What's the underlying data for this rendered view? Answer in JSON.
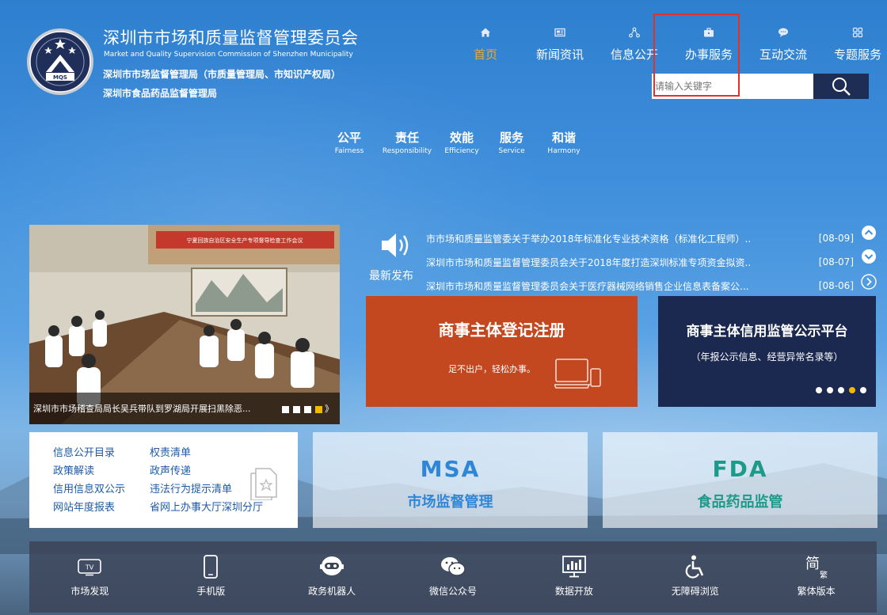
{
  "header": {
    "title": "深圳市市场和质量监督管理委员会",
    "title_en": "Market and Quality Supervision Commission of Shenzhen Municipality",
    "sub1": "深圳市市场监督管理局（市质量管理局、市知识产权局）",
    "sub2": "深圳市食品药品监督管理局",
    "logo_text": "MQS"
  },
  "nav": {
    "items": [
      {
        "label": "首页",
        "icon": "home-icon",
        "active": true
      },
      {
        "label": "新闻资讯",
        "icon": "newspaper-icon"
      },
      {
        "label": "信息公开",
        "icon": "network-icon"
      },
      {
        "label": "办事服务",
        "icon": "briefcase-icon"
      },
      {
        "label": "互动交流",
        "icon": "chat-icon"
      },
      {
        "label": "专题服务",
        "icon": "grid-icon"
      }
    ]
  },
  "search": {
    "placeholder": "请输入关键字"
  },
  "values": [
    {
      "zh": "公平",
      "en": "Fairness"
    },
    {
      "zh": "责任",
      "en": "Responsibility"
    },
    {
      "zh": "效能",
      "en": "Efficiency"
    },
    {
      "zh": "服务",
      "en": "Service"
    },
    {
      "zh": "和谐",
      "en": "Harmony"
    }
  ],
  "slider": {
    "caption": "深圳市市场稽查局局长吴兵带队到罗湖局开展扫黑除恶...",
    "banner_text": "宁夏回族自治区安全生产专项督导检查工作会议",
    "next": "》",
    "active_dot": 4
  },
  "news": {
    "label": "最新发布",
    "items": [
      {
        "title": "市市场和质量监管委关于举办2018年标准化专业技术资格（标准化工程师）..",
        "date": "[08-09]"
      },
      {
        "title": "深圳市市场和质量监督管理委员会关于2018年度打造深圳标准专项资金拟资..",
        "date": "[08-07]"
      },
      {
        "title": "深圳市市场和质量监督管理委员会关于医疗器械网络销售企业信息表备案公...",
        "date": "[08-06]"
      }
    ]
  },
  "cards": {
    "register_title": "商事主体登记注册",
    "register_sub": "足不出户，轻松办事。",
    "credit_title": "商事主体信用监管公示平台",
    "credit_sub": "（年报公示信息、经营异常名录等）"
  },
  "links": [
    "信息公开目录",
    "权责清单",
    "政策解读",
    "政声传递",
    "信用信息双公示",
    "违法行为提示清单",
    "网站年度报表",
    "省网上办事大厅深圳分厅"
  ],
  "brands": {
    "msa_logo": "MSA",
    "msa_name": "市场监督管理",
    "fda_logo": "FDA",
    "fda_name": "食品药品监管"
  },
  "bottom": [
    {
      "label": "市场发现",
      "icon": "tv-icon",
      "glyph": "TV"
    },
    {
      "label": "手机版",
      "icon": "mobile-icon"
    },
    {
      "label": "政务机器人",
      "icon": "robot-icon"
    },
    {
      "label": "微信公众号",
      "icon": "wechat-icon"
    },
    {
      "label": "数据开放",
      "icon": "chart-monitor-icon"
    },
    {
      "label": "无障碍浏览",
      "icon": "accessibility-icon"
    },
    {
      "label": "繁体版本",
      "icon": "traditional-chinese-icon",
      "glyph": "简",
      "glyph_small": "繁"
    }
  ],
  "colors": {
    "accent_orange": "#f5a623",
    "register_card": "#c4481f",
    "credit_card": "#1b2850",
    "msa_blue": "#2f86d6",
    "fda_green": "#1d9a8a",
    "highlight_red": "#e0312b"
  }
}
